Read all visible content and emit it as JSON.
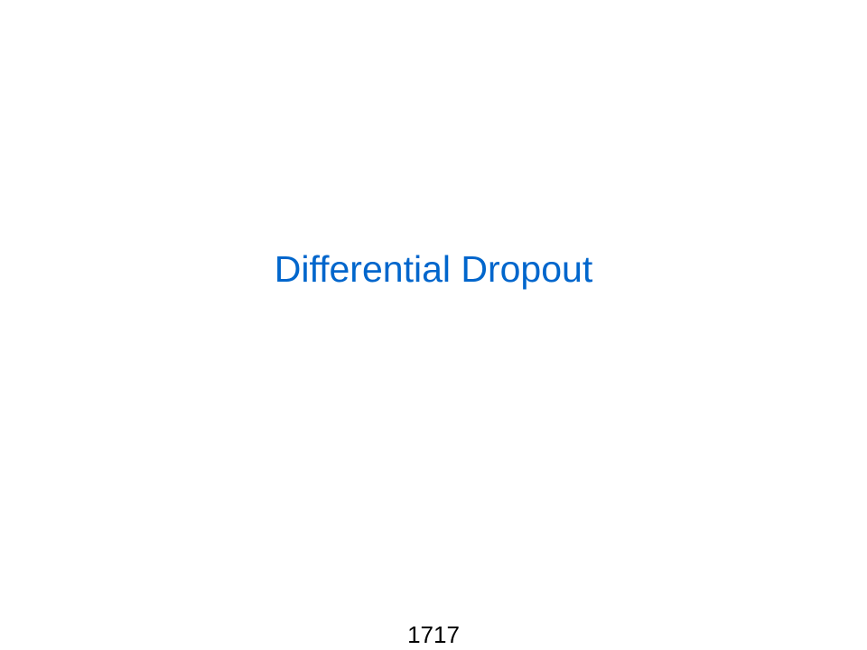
{
  "slide": {
    "title": "Differential Dropout",
    "page_number": "1717",
    "title_color": "#0066cc"
  }
}
